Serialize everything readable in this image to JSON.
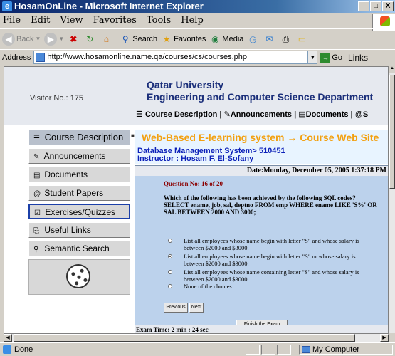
{
  "window": {
    "title": "HosamOnLine - Microsoft Internet Explorer",
    "buttons": [
      "_",
      "□",
      "X"
    ]
  },
  "menu": [
    "File",
    "Edit",
    "View",
    "Favorites",
    "Tools",
    "Help"
  ],
  "toolbar": {
    "back": "Back",
    "search": "Search",
    "favorites": "Favorites",
    "media": "Media"
  },
  "address": {
    "label": "Address",
    "url": "http://www.hosamonline.name.qa/courses/cs/courses.php",
    "go": "Go",
    "links": "Links"
  },
  "page": {
    "visitor": "Visitor No.: 175",
    "university": "Qatar University",
    "department": "Engineering and Computer Science Department",
    "topnav": [
      "Course Description",
      "Announcements",
      "Documents",
      "S"
    ],
    "sidebar": [
      {
        "label": "Course Description",
        "icon": "list-icon"
      },
      {
        "label": "Announcements",
        "icon": "edit-icon"
      },
      {
        "label": "Documents",
        "icon": "document-icon"
      },
      {
        "label": "Student Papers",
        "icon": "paper-icon"
      },
      {
        "label": "Exercises/Quizzes",
        "icon": "checkbox-icon"
      },
      {
        "label": "Useful Links",
        "icon": "link-icon"
      },
      {
        "label": "Semantic Search",
        "icon": "search-icon"
      }
    ],
    "banner": {
      "title": "Web-Based E-learning system → Course Web Site",
      "course": "Database Management System> 510451",
      "instructor": "Instructor : Hosam F. El-Sofany"
    },
    "exam": {
      "date": "Date:Monday, December 05, 2005 1:37:18 PM",
      "question_no": "Question No: 16 of 20",
      "question": "Which of the following has been achieved by the following SQL codes? SELECT ename, job, sal, deptno FROM emp WHERE ename LIKE 'S%' OR SAL BETWEEN 2000 AND 3000;",
      "options": [
        "List all employees whose name begin with letter \"S\" and whose salary is between $2000 and $3000.",
        "List all employees whose name begin with letter \"S\" or whose salary is between $2000 and $3000.",
        "List all employees whose name containing letter \"S\" and whose salary is between $2000 and $3000.",
        "None of the choices"
      ],
      "selected_index": 1,
      "previous": "Previous",
      "next": "Next",
      "finish": "Finish the Exam",
      "time": "Exam Time:  2  min : 24 sec"
    }
  },
  "status": {
    "text": "Done",
    "zone": "My Computer"
  }
}
